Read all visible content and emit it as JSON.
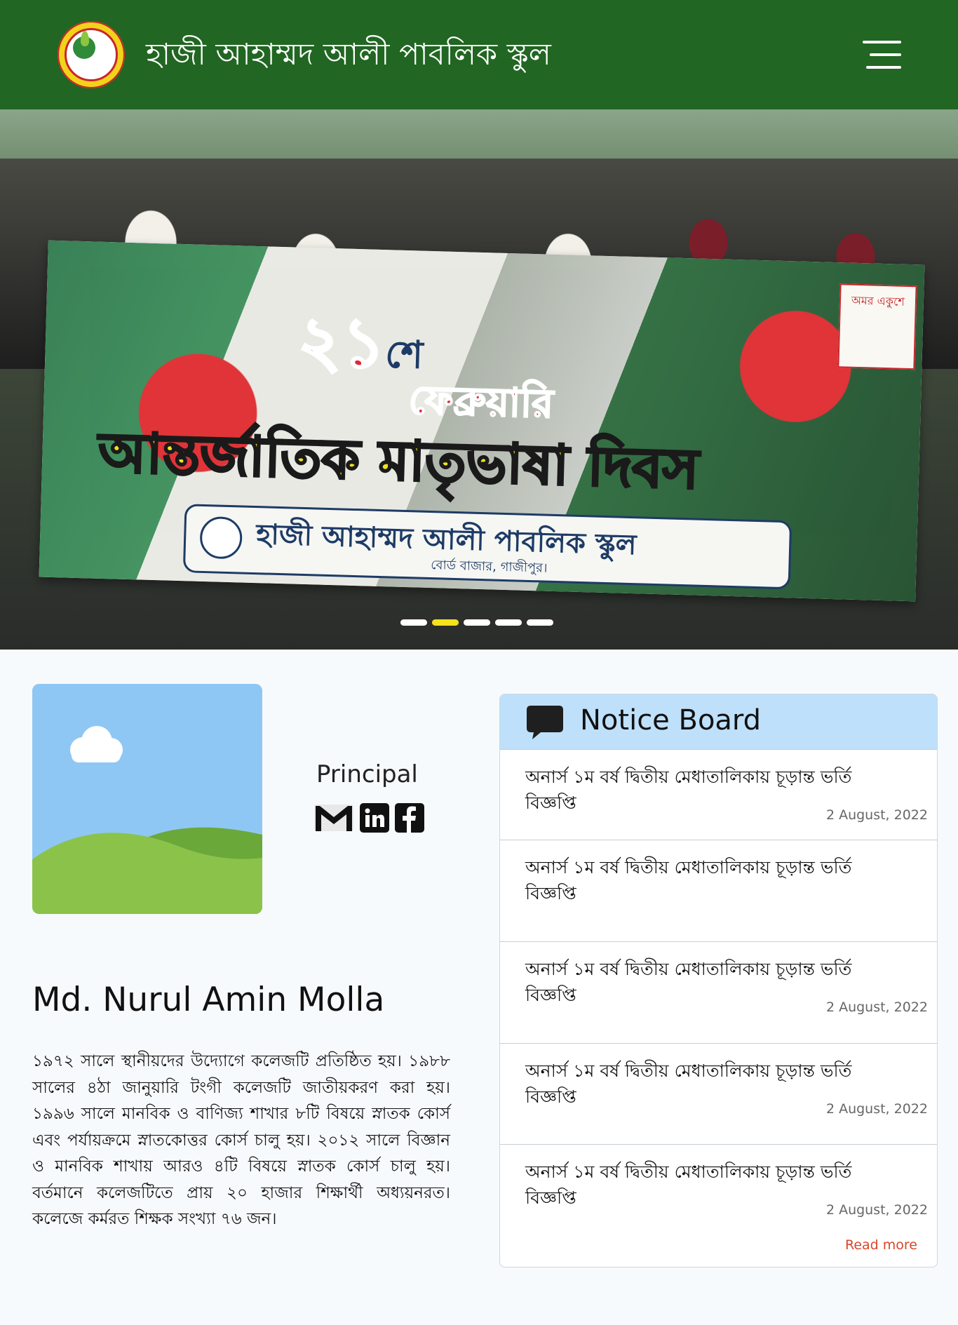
{
  "header": {
    "title": "হাজী আহাম্মদ আলী পাবলিক স্কুল",
    "logo_icon": "school-logo-icon",
    "menu_icon": "hamburger-menu-icon",
    "background": "#216622"
  },
  "hero": {
    "banner_number": "২১",
    "banner_suffix": "শে",
    "banner_month": "ফেব্রুয়ারি",
    "banner_title": "আন্তর্জাতিক মাতৃভাষা দিবস",
    "banner_school": "হাজী আহাম্মদ আলী পাবলিক স্কুল",
    "banner_location": "বোর্ড বাজার, গাজীপুর।",
    "banner_corner": "অমর একুশে",
    "slides": 5,
    "active_slide": 2,
    "active_dot_color": "#f4e21a"
  },
  "principal": {
    "photo_icon": "image-placeholder-icon",
    "role": "Principal",
    "socials": [
      "gmail-icon",
      "linkedin-icon",
      "facebook-icon"
    ],
    "name": "Md. Nurul Amin Molla",
    "bio": "১৯৭২ সালে স্থানীয়দের উদ্যোগে কলেজটি প্রতিষ্ঠিত হয়। ১৯৮৮ সালের ৪ঠা জানুয়ারি টংগী কলেজটি জাতীয়করণ করা হয়। ১৯৯৬ সালে মানবিক ও বাণিজ্য শাখার ৮টি বিষয়ে স্নাতক কোর্স এবং পর্যায়ক্রমে স্নাতকোত্তর কোর্স চালু হয়। ২০১২ সালে বিজ্ঞান ও মানবিক শাখায় আরও ৪টি বিষয়ে স্নাতক কোর্স চালু হয়। বর্তমানে কলেজটিতে প্রায় ২০ হাজার শিক্ষার্থী অধ্যয়নরত। কলেজে কর্মরত শিক্ষক সংখ্যা ৭৬ জন।"
  },
  "notice_board": {
    "title": "Notice Board",
    "icon": "chat-bubble-icon",
    "header_color": "#bfe0fb",
    "items": [
      {
        "text": "অনার্স ১ম বর্ষ দ্বিতীয় মেধাতালিকায় চূড়ান্ত ভর্তি বিজ্ঞপ্তি",
        "date": "2 August, 2022"
      },
      {
        "text": "অনার্স ১ম বর্ষ দ্বিতীয় মেধাতালিকায় চূড়ান্ত ভর্তি বিজ্ঞপ্তি",
        "date": ""
      },
      {
        "text": "অনার্স ১ম বর্ষ দ্বিতীয় মেধাতালিকায় চূড়ান্ত ভর্তি বিজ্ঞপ্তি",
        "date": "2 August, 2022"
      },
      {
        "text": "অনার্স ১ম বর্ষ দ্বিতীয় মেধাতালিকায় চূড়ান্ত ভর্তি বিজ্ঞপ্তি",
        "date": "2 August, 2022"
      },
      {
        "text": "অনার্স ১ম বর্ষ দ্বিতীয় মেধাতালিকায় চূড়ান্ত ভর্তি বিজ্ঞপ্তি",
        "date": "2 August, 2022"
      }
    ],
    "read_more": "Read more",
    "read_more_color": "#d9462a"
  }
}
